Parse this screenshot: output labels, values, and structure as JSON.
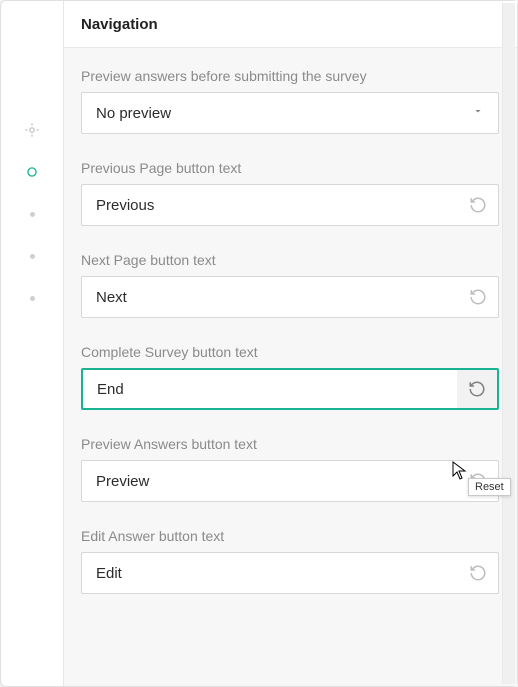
{
  "section": {
    "title": "Navigation"
  },
  "fields": {
    "preview_mode": {
      "label": "Preview answers before submitting the survey",
      "value": "No preview"
    },
    "prev_text": {
      "label": "Previous Page button text",
      "value": "Previous"
    },
    "next_text": {
      "label": "Next Page button text",
      "value": "Next"
    },
    "complete_text": {
      "label": "Complete Survey button text",
      "value": "End"
    },
    "preview_text": {
      "label": "Preview Answers button text",
      "value": "Preview"
    },
    "edit_text": {
      "label": "Edit Answer button text",
      "value": "Edit"
    }
  },
  "tooltip": {
    "reset": "Reset"
  },
  "colors": {
    "accent": "#19b394"
  }
}
